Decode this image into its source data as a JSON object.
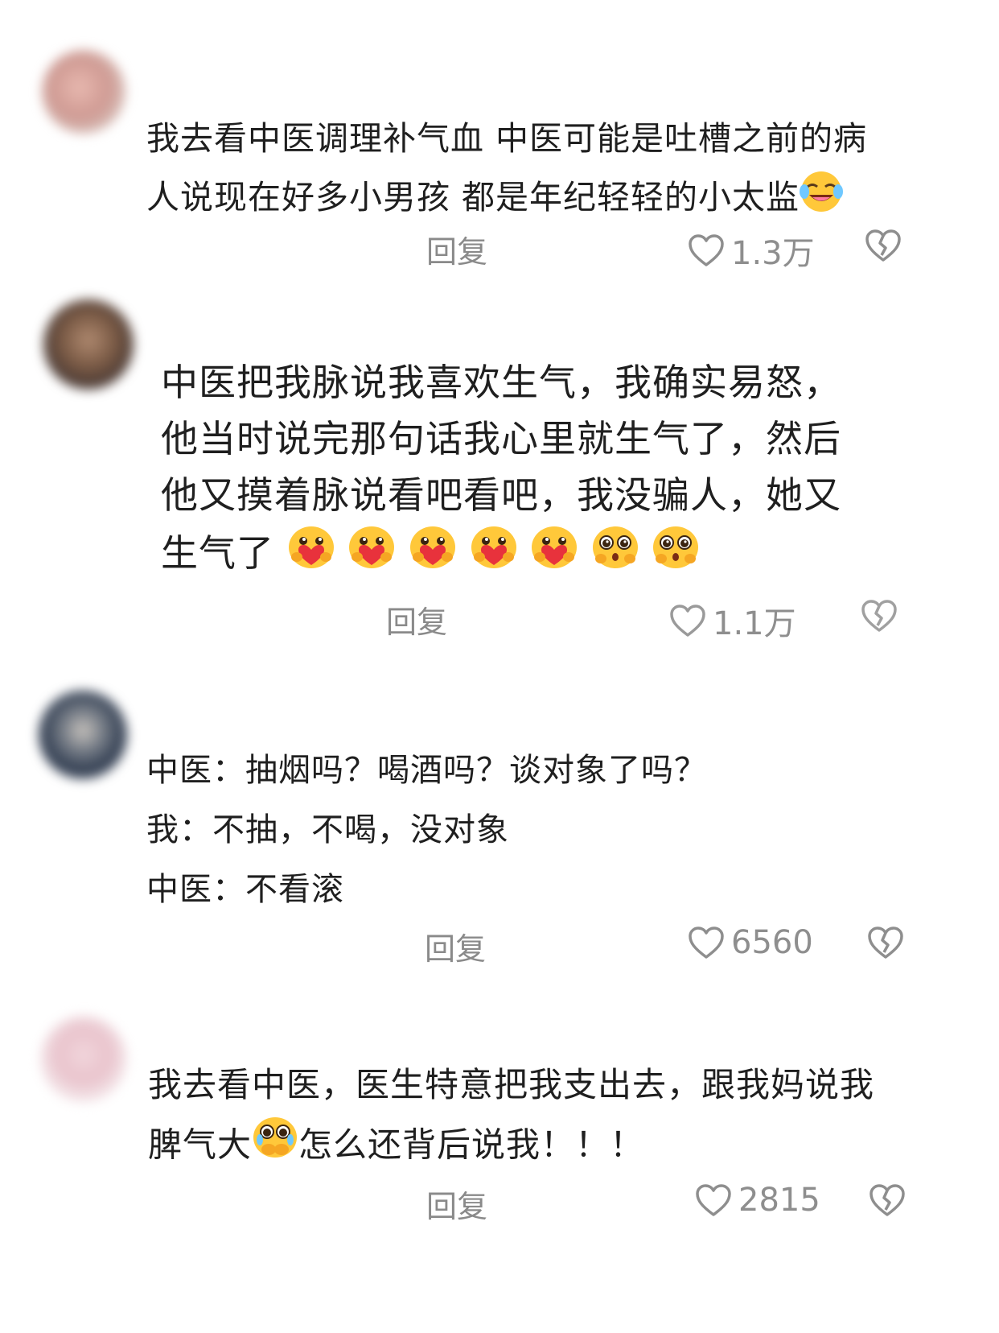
{
  "comments": [
    {
      "lines": [
        "我去看中医调理补气血 中医可能是吐槽之前的病",
        "人说现在好多小男孩 都是年纪轻轻的小太监"
      ],
      "emoji_after": [
        "crying-laughing"
      ],
      "reply_label": "回复",
      "likes": "1.3万"
    },
    {
      "lines": [
        "中医把我脉说我喜欢生气，我确实易怒，",
        "他当时说完那句话我心里就生气了，然后",
        "他又摸着脉说看吧看吧，我没骗人，她又",
        "生气了"
      ],
      "emoji_after": [
        "heart-hug",
        "heart-hug",
        "heart-hug",
        "heart-hug",
        "heart-hug",
        "pleading",
        "pleading"
      ],
      "reply_label": "回复",
      "likes": "1.1万"
    },
    {
      "lines": [
        "中医：抽烟吗？喝酒吗？谈对象了吗？",
        "我：不抽，不喝，没对象",
        "中医：不看滚"
      ],
      "emoji_after": [],
      "reply_label": "回复",
      "likes": "6560"
    },
    {
      "lines": [
        "我去看中医，医生特意把我支出去，跟我妈说我",
        "脾气大",
        "怎么还背后说我！！！"
      ],
      "emoji_after": [
        "tearful-cover"
      ],
      "reply_label": "回复",
      "likes": "2815"
    }
  ],
  "colors": {
    "text": "#1f1f1f",
    "meta": "#8a8a8a",
    "emoji_yellow": "#ffc83a",
    "heart_red": "#e8323c"
  }
}
